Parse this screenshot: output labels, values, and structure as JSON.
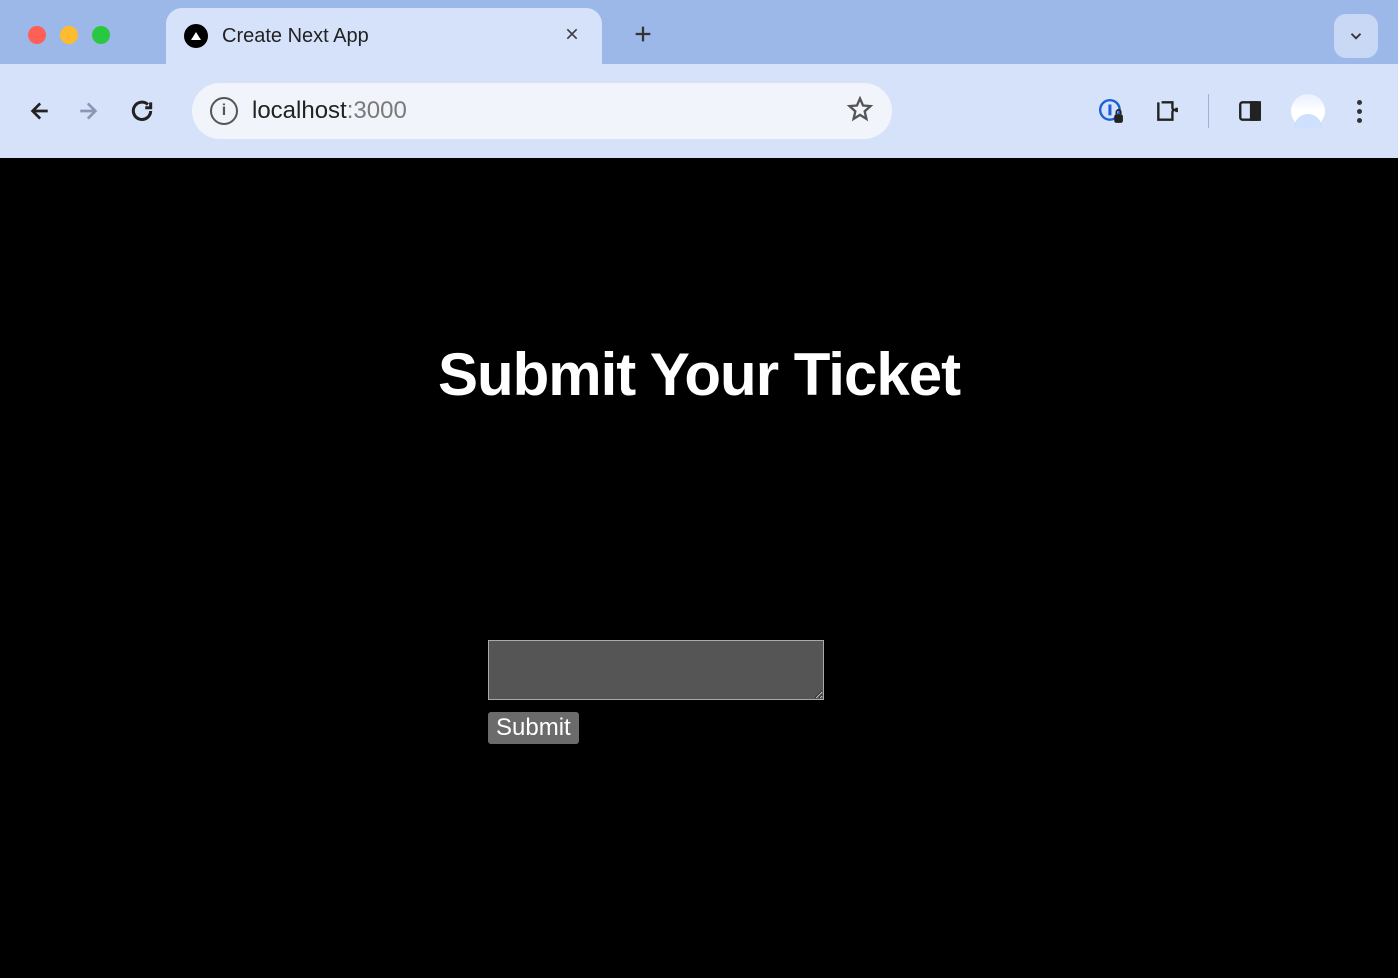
{
  "browser": {
    "tab_title": "Create Next App",
    "address": {
      "host": "localhost",
      "port": ":3000"
    },
    "icons": {
      "close_tab": "close-icon",
      "new_tab": "plus-icon",
      "back": "arrow-left-icon",
      "forward": "arrow-right-icon",
      "reload": "reload-icon",
      "site_info": "info-icon",
      "bookmark": "star-icon",
      "onepassword": "onepassword-icon",
      "extensions": "puzzle-icon",
      "side_panel": "side-panel-icon",
      "profile": "avatar",
      "menu": "kebab-icon",
      "tab_search": "chevron-down-icon"
    }
  },
  "page": {
    "heading": "Submit Your Ticket",
    "form": {
      "textarea_value": "",
      "submit_label": "Submit"
    }
  }
}
